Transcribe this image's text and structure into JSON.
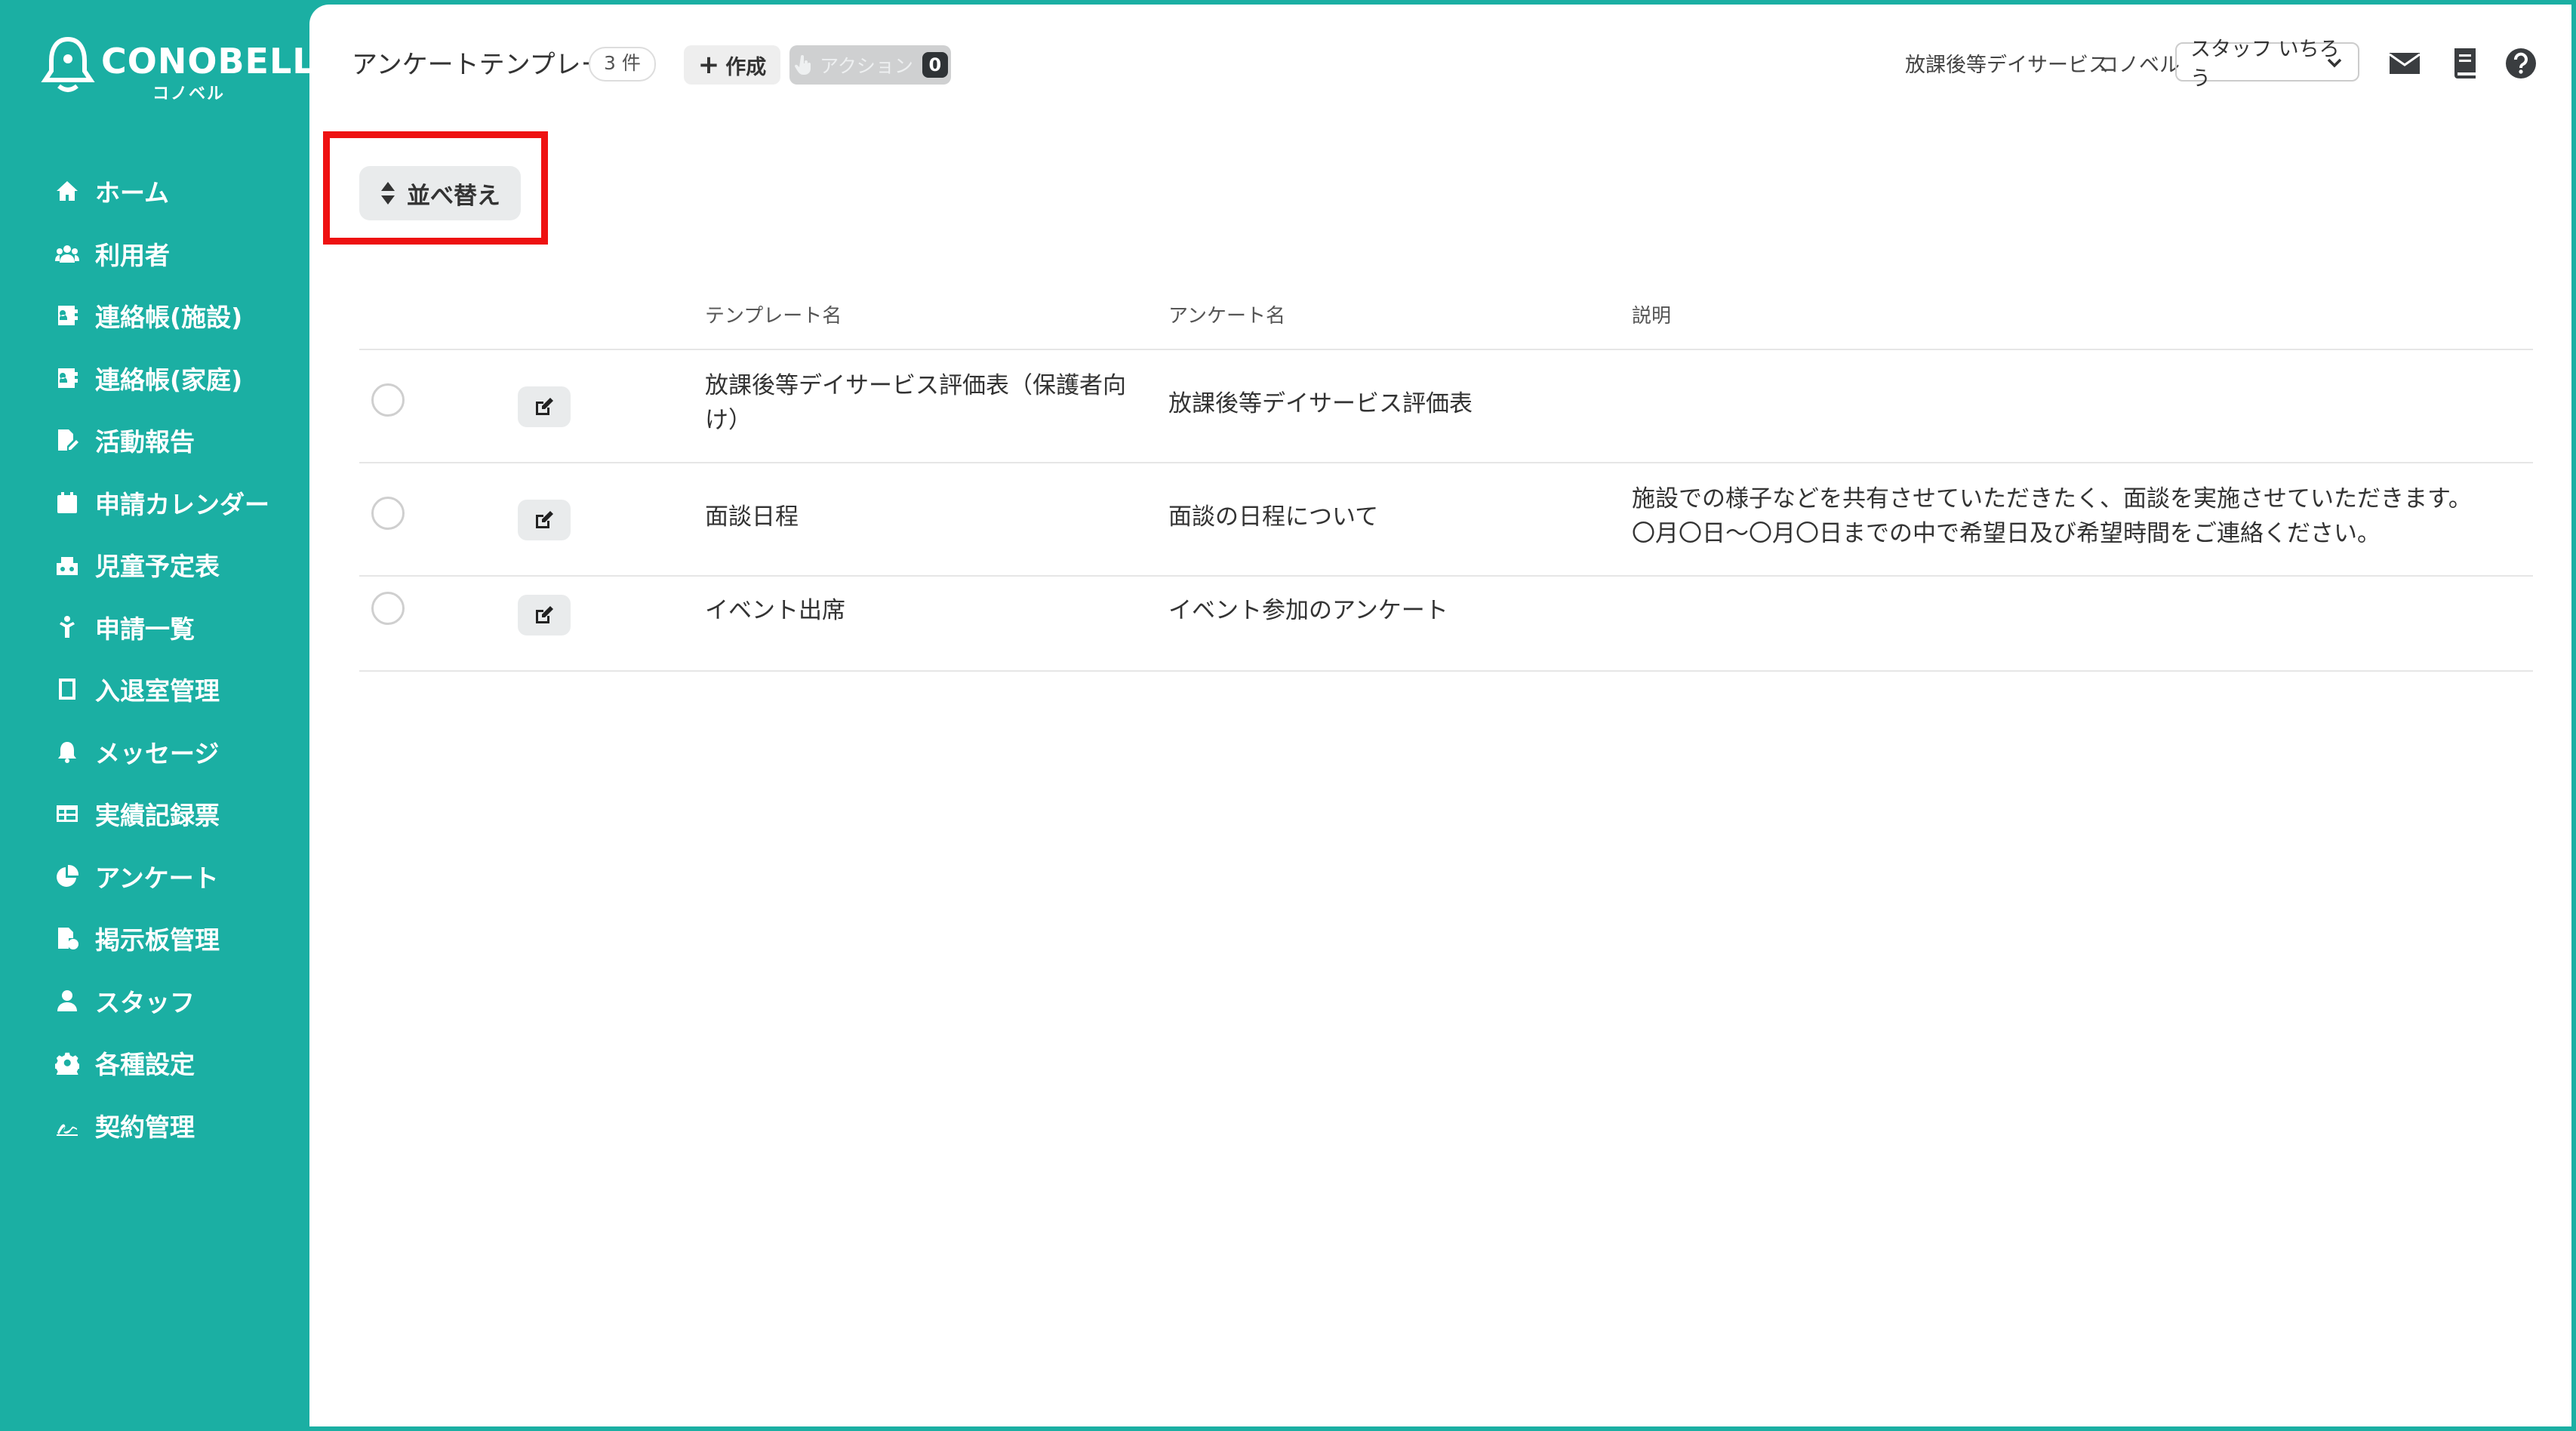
{
  "brand": {
    "name": "CONOBELL",
    "sub": "コノベル"
  },
  "sidebar": {
    "items": [
      {
        "label": "ホーム",
        "icon": "home-icon"
      },
      {
        "label": "利用者",
        "icon": "users-icon"
      },
      {
        "label": "連絡帳(施設)",
        "icon": "contact-book-icon"
      },
      {
        "label": "連絡帳(家庭)",
        "icon": "contact-book-icon"
      },
      {
        "label": "活動報告",
        "icon": "report-icon"
      },
      {
        "label": "申請カレンダー",
        "icon": "calendar-icon"
      },
      {
        "label": "児童予定表",
        "icon": "children-schedule-icon"
      },
      {
        "label": "申請一覧",
        "icon": "request-list-icon"
      },
      {
        "label": "入退室管理",
        "icon": "tablet-icon"
      },
      {
        "label": "メッセージ",
        "icon": "bell-icon"
      },
      {
        "label": "実績記録票",
        "icon": "table-icon"
      },
      {
        "label": "アンケート",
        "icon": "pie-chart-icon"
      },
      {
        "label": "掲示板管理",
        "icon": "bulletin-icon"
      },
      {
        "label": "スタッフ",
        "icon": "staff-icon"
      },
      {
        "label": "各種設定",
        "icon": "gear-icon"
      },
      {
        "label": "契約管理",
        "icon": "contract-icon"
      }
    ]
  },
  "header": {
    "title": "アンケートテンプレート",
    "count": "3 件",
    "create_label": "作成",
    "action_label": "アクション",
    "action_count": "0",
    "facility": "放課後等デイサービス",
    "company": "コノベル",
    "staff_selected": "スタッフ いちろう"
  },
  "toolbar": {
    "sort_label": "並べ替え"
  },
  "table": {
    "columns": [
      "テンプレート名",
      "アンケート名",
      "説明"
    ],
    "rows": [
      {
        "template_name": "放課後等デイサービス評価表（保護者向け）",
        "survey_name": "放課後等デイサービス評価表",
        "description_lines": [
          "",
          ""
        ]
      },
      {
        "template_name": "面談日程",
        "survey_name": "面談の日程について",
        "description_lines": [
          "施設での様子などを共有させていただきたく、面談を実施させていただきます。",
          "〇月〇日～〇月〇日までの中で希望日及び希望時間をご連絡ください。"
        ]
      },
      {
        "template_name": "イベント出席",
        "survey_name": "イベント参加のアンケート",
        "description_lines": [
          "",
          ""
        ]
      }
    ]
  },
  "colors": {
    "brand": "#1bafa3",
    "highlight": "#ee1111"
  }
}
